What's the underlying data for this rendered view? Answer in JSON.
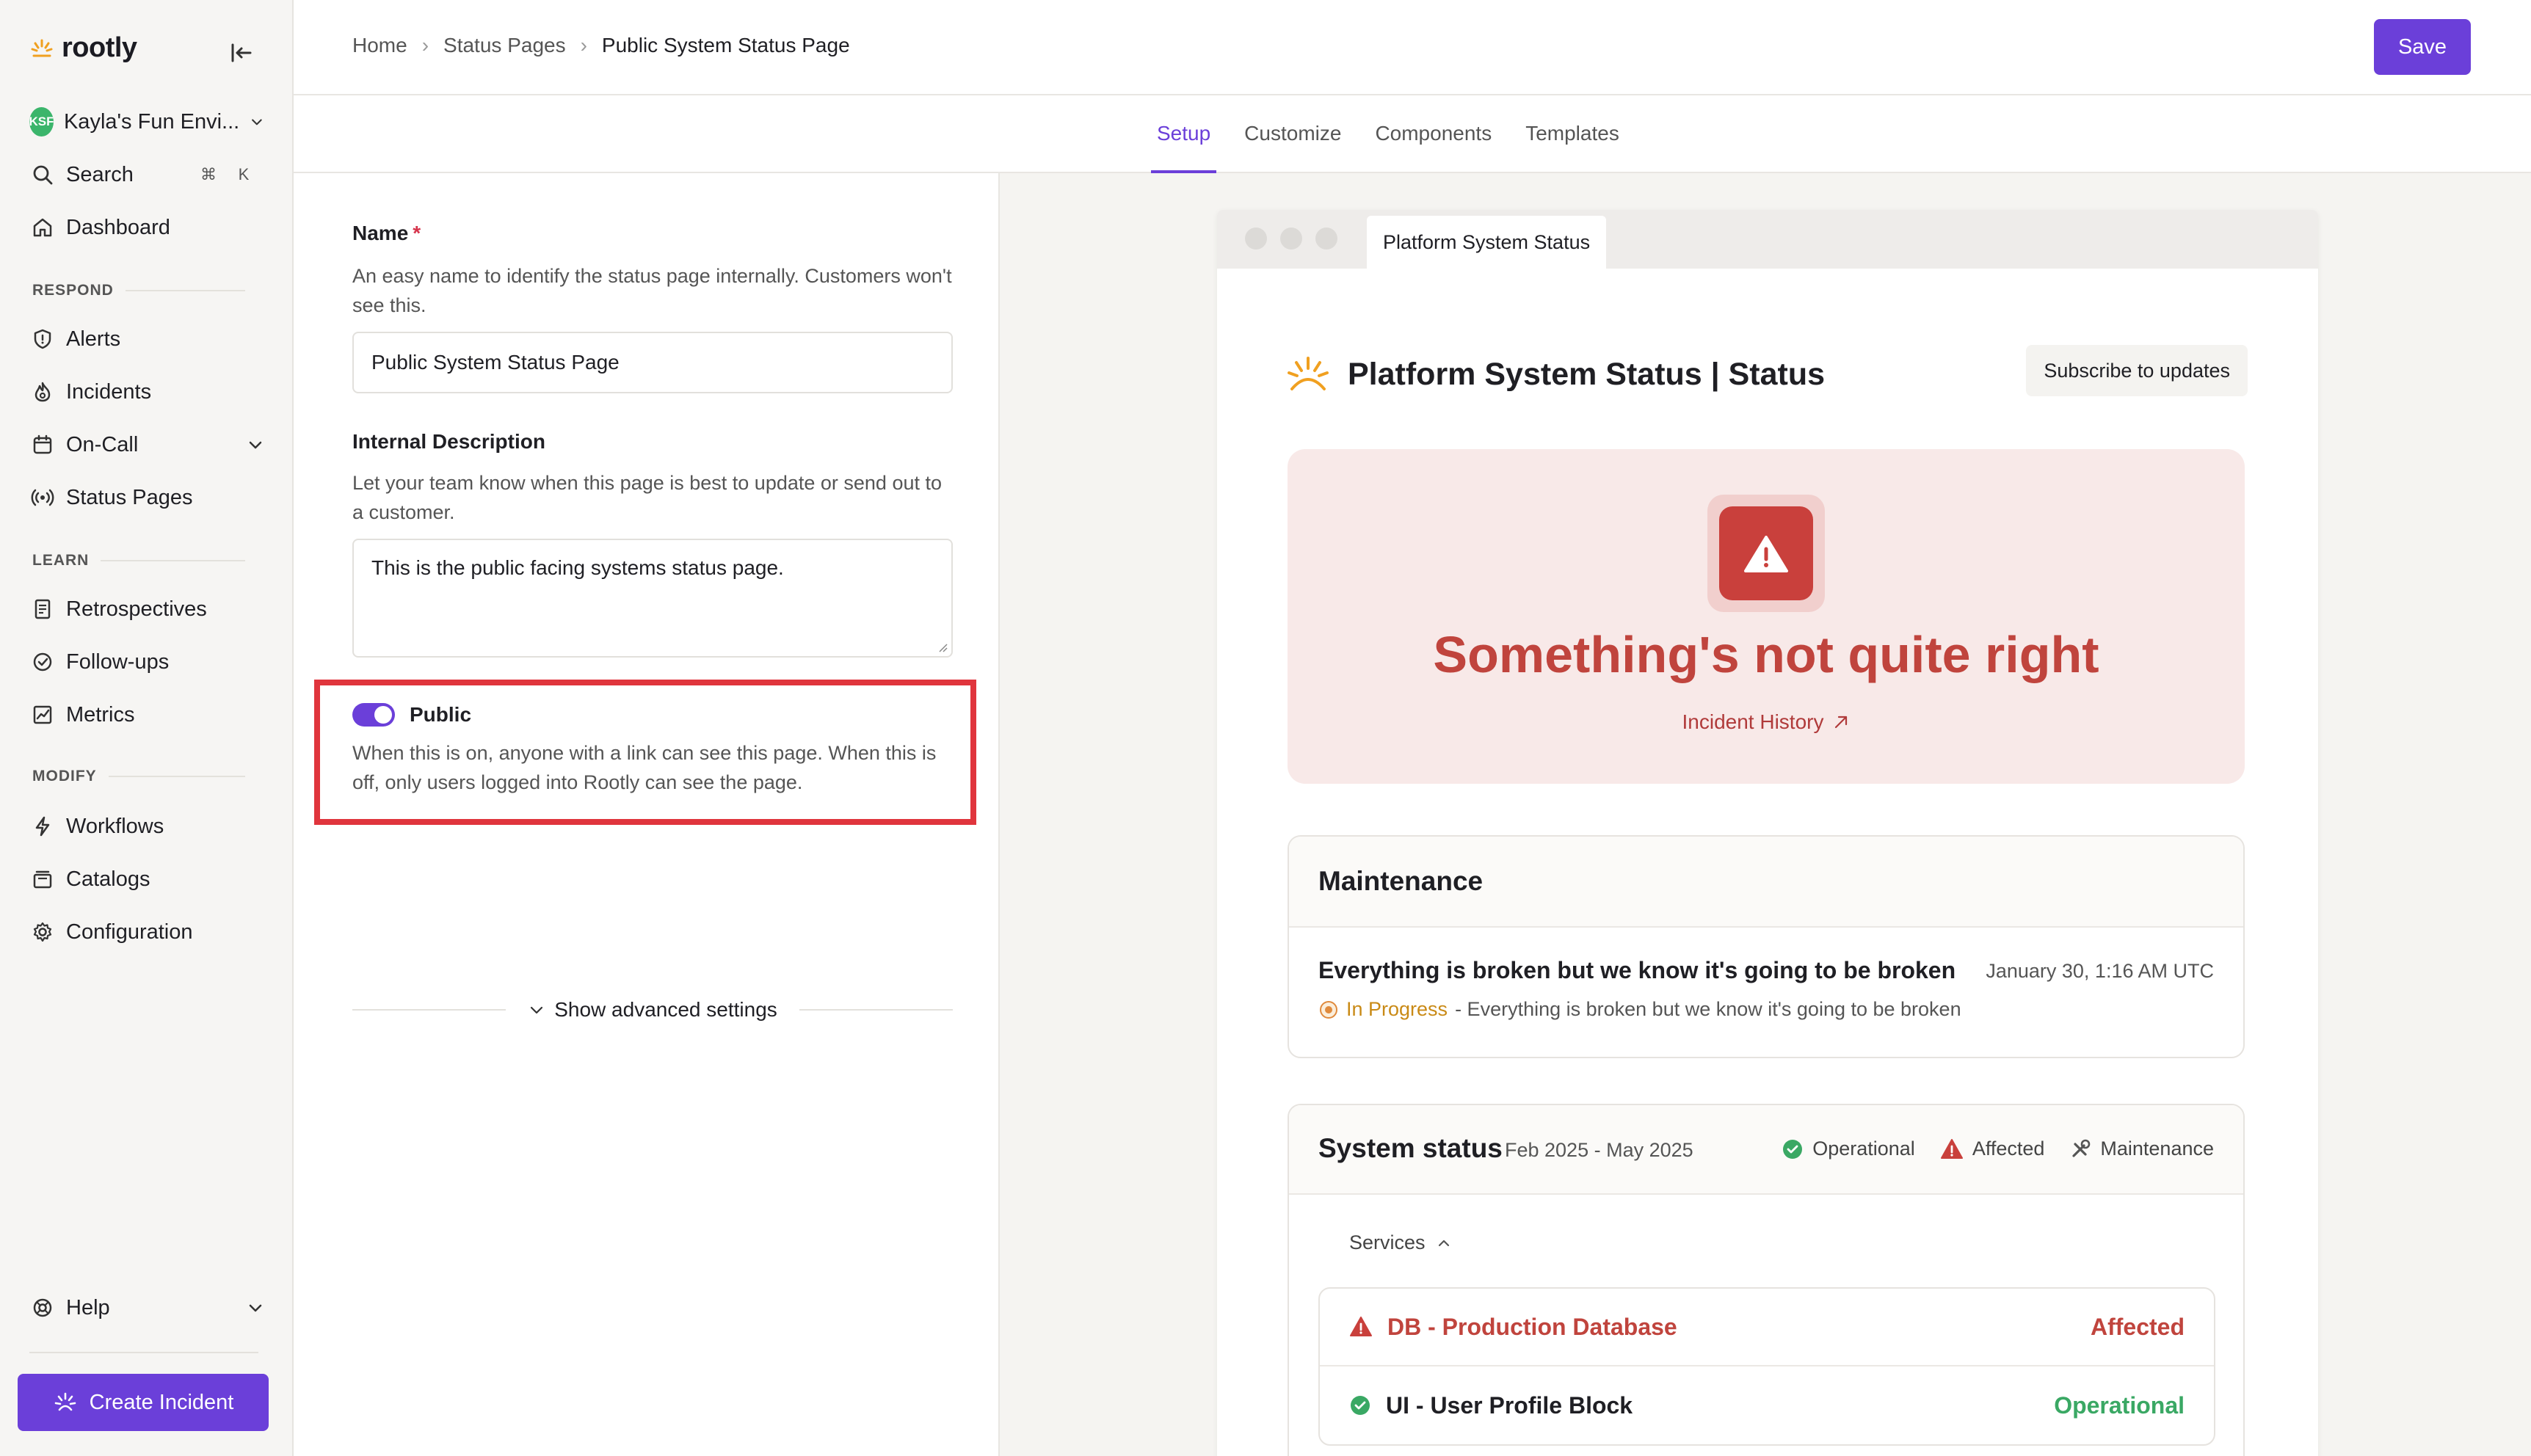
{
  "app": {
    "brand": "rootly"
  },
  "sidebar": {
    "environment": {
      "initials": "KSF",
      "name": "Kayla's Fun Envi..."
    },
    "search": {
      "label": "Search",
      "shortcut_cmd": "⌘",
      "shortcut_key": "K"
    },
    "dashboard": "Dashboard",
    "sections": {
      "respond": "RESPOND",
      "learn": "LEARN",
      "modify": "MODIFY"
    },
    "respond_items": [
      "Alerts",
      "Incidents",
      "On-Call",
      "Status Pages"
    ],
    "learn_items": [
      "Retrospectives",
      "Follow-ups",
      "Metrics"
    ],
    "modify_items": [
      "Workflows",
      "Catalogs",
      "Configuration"
    ],
    "help": "Help",
    "create_incident": "Create Incident"
  },
  "header": {
    "breadcrumb": [
      "Home",
      "Status Pages",
      "Public System Status Page"
    ],
    "save_label": "Save"
  },
  "tabs": [
    "Setup",
    "Customize",
    "Components",
    "Templates"
  ],
  "active_tab": "Setup",
  "form": {
    "name": {
      "title": "Name",
      "required_mark": "*",
      "help": "An easy name to identify the status page internally. Customers won't see this.",
      "value": "Public System Status Page"
    },
    "description": {
      "title": "Internal Description",
      "help": "Let your team know when this page is best to update or send out to a customer.",
      "value": "This is the public facing systems status page."
    },
    "public": {
      "title": "Public",
      "enabled": true,
      "help": "When this is on, anyone with a link can see this page. When this is off, only users logged into Rootly can see the page."
    },
    "advanced": "Show advanced settings"
  },
  "preview": {
    "browser_tab": "Platform System Status",
    "page_title": "Platform System Status | Status",
    "subscribe": "Subscribe to updates",
    "alert": {
      "title": "Something's not quite right",
      "link": "Incident History"
    },
    "maintenance": {
      "header": "Maintenance",
      "item_title": "Everything is broken but we know it's going to be broken",
      "date": "January 30, 1:16 AM UTC",
      "status": "In Progress",
      "description": "- Everything is broken but we know it's going to be broken"
    },
    "system_status": {
      "title": "System status",
      "range": "Feb 2025 - May 2025",
      "legend": [
        "Operational",
        "Affected",
        "Maintenance"
      ],
      "services_label": "Services",
      "services": [
        {
          "name": "DB - Production Database",
          "state": "Affected"
        },
        {
          "name": "UI - User Profile Block",
          "state": "Operational"
        }
      ]
    }
  },
  "colors": {
    "accent": "#6b3fd9",
    "affected": "#c0443d",
    "operational": "#3aa864",
    "in_progress": "#c98a16",
    "highlight": "#e0353d"
  }
}
